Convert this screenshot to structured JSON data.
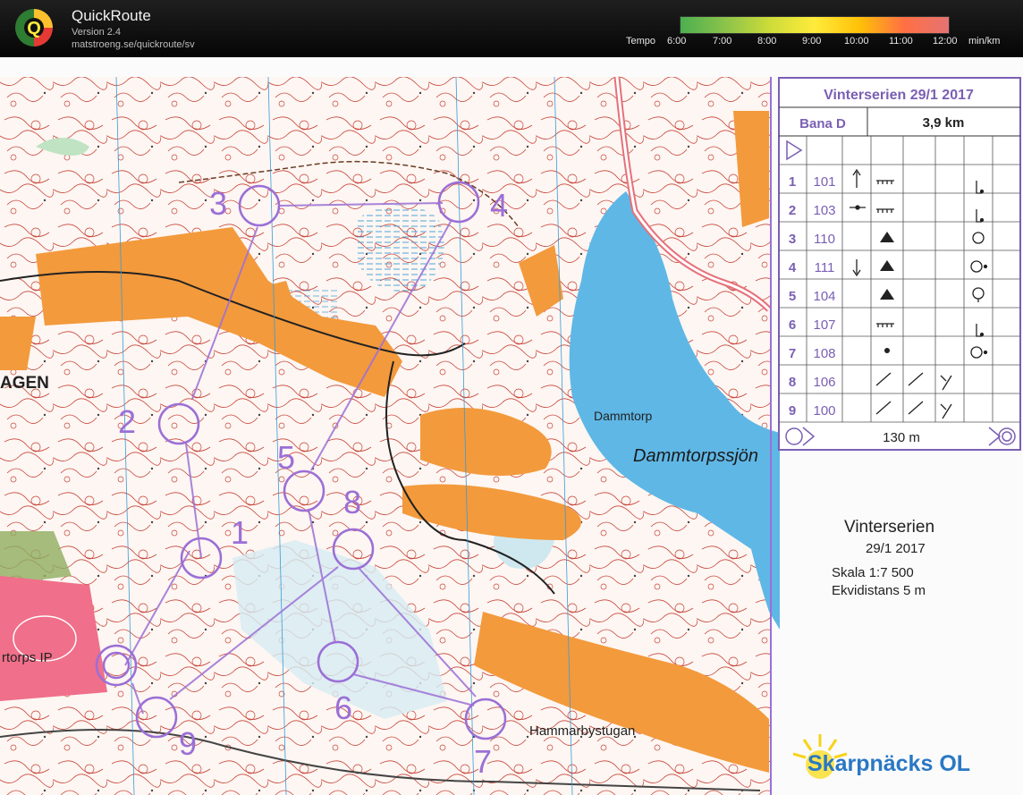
{
  "app": {
    "title": "QuickRoute",
    "version": "Version 2.4",
    "url": "matstroeng.se/quickroute/sv"
  },
  "tempo": {
    "label": "Tempo",
    "ticks": [
      "6:00",
      "7:00",
      "8:00",
      "9:00",
      "10:00",
      "11:00",
      "12:00"
    ],
    "unit": "min/km",
    "colors": [
      "#4caf50",
      "#8bc34a",
      "#cddc39",
      "#ffeb3b",
      "#ffc107",
      "#ff7043",
      "#e57373"
    ]
  },
  "map": {
    "labels": {
      "area_west": "AGEN",
      "dammtorp": "Dammtorp",
      "lake": "Dammtorpssjön",
      "sports": "rtorps IP",
      "hammarbystugan": "Hammarbystugan"
    },
    "control_numbers": [
      "1",
      "2",
      "3",
      "4",
      "5",
      "6",
      "7",
      "8",
      "9"
    ],
    "colors": {
      "course": "#9b6fd6",
      "water": "#5fb7e6",
      "open": "#f39a3c",
      "contour": "#c8453a",
      "paper": "#fdf8f4"
    }
  },
  "card": {
    "event": "Vinterserien 29/1 2017",
    "course": "Bana D",
    "length": "3,9 km",
    "rows": [
      {
        "num": "1",
        "code": "101"
      },
      {
        "num": "2",
        "code": "103"
      },
      {
        "num": "3",
        "code": "110"
      },
      {
        "num": "4",
        "code": "111"
      },
      {
        "num": "5",
        "code": "104"
      },
      {
        "num": "6",
        "code": "107"
      },
      {
        "num": "7",
        "code": "108"
      },
      {
        "num": "8",
        "code": "106"
      },
      {
        "num": "9",
        "code": "100"
      }
    ],
    "finish_distance": "130 m"
  },
  "info": {
    "title": "Vinterserien",
    "date": "29/1 2017",
    "scale": "Skala 1:7 500",
    "contour": "Ekvidistans 5 m"
  },
  "brand": {
    "text": "Skarpnäcks OL"
  }
}
